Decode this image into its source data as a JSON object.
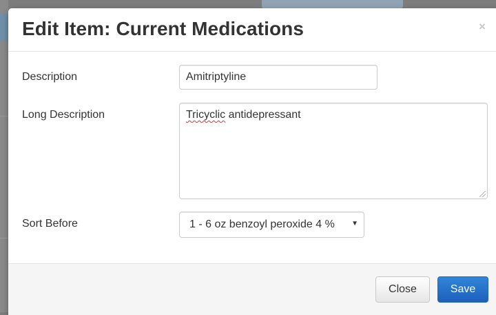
{
  "dialog": {
    "title": "Edit Item: Current Medications",
    "close_symbol": "×"
  },
  "form": {
    "description": {
      "label": "Description",
      "value": "Amitriptyline"
    },
    "long_description": {
      "label": "Long Description",
      "value_word1": "Tricyclic",
      "value_rest": " antidepressant"
    },
    "sort_before": {
      "label": "Sort Before",
      "selected": "1 - 6 oz benzoyl peroxide 4 %",
      "arrow": "▼"
    }
  },
  "footer": {
    "close_label": "Close",
    "save_label": "Save"
  },
  "colors": {
    "primary": "#1d5fbc",
    "backdrop": "#7d7d7d"
  }
}
